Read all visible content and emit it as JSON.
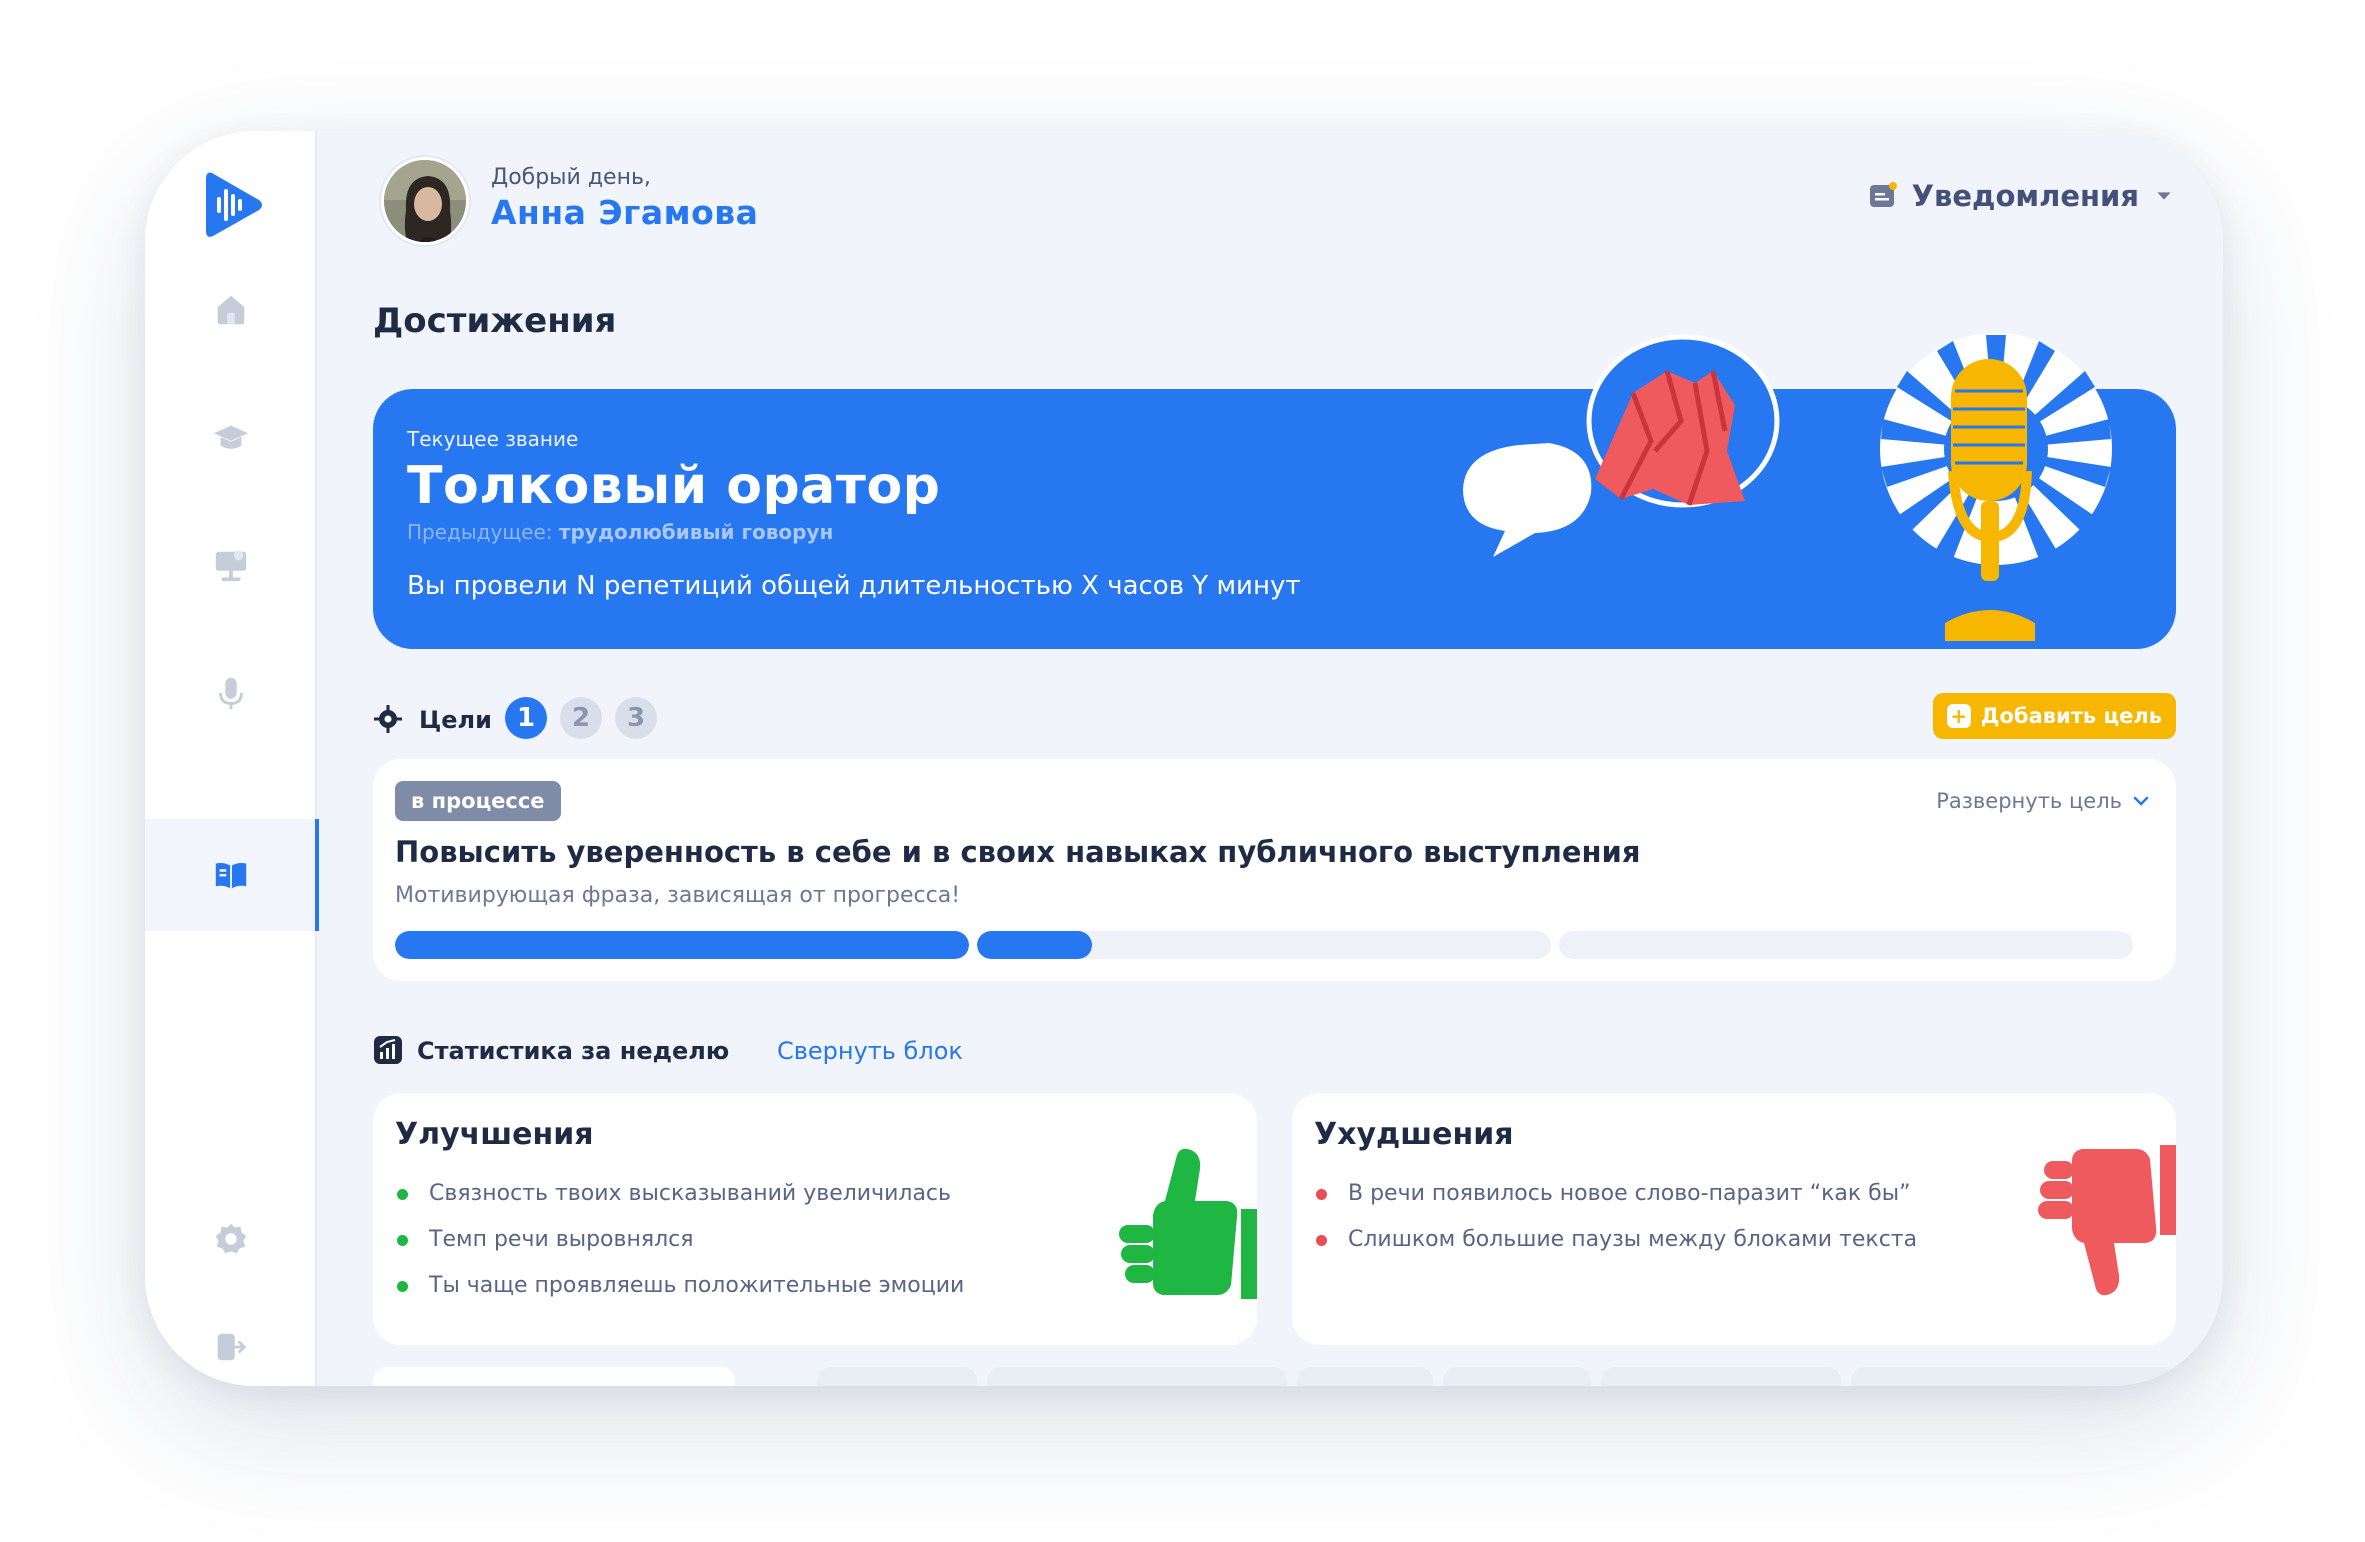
{
  "header": {
    "greeting": "Добрый день,",
    "user_name": "Анна Эгамова",
    "notifications_label": "Уведомления"
  },
  "sidebar": {
    "items": [
      {
        "name": "home",
        "icon": "home-icon"
      },
      {
        "name": "courses",
        "icon": "graduation-cap-icon"
      },
      {
        "name": "presentations",
        "icon": "presentation-icon"
      },
      {
        "name": "recording",
        "icon": "microphone-icon"
      },
      {
        "name": "achievements",
        "icon": "book-icon",
        "active": true
      },
      {
        "name": "settings",
        "icon": "gear-icon"
      },
      {
        "name": "logout",
        "icon": "logout-icon"
      }
    ]
  },
  "page": {
    "title": "Достижения"
  },
  "banner": {
    "current_rank_label": "Текущее звание",
    "current_rank": "Толковый оратор",
    "previous_prefix": "Предыдущее:",
    "previous_rank": "трудолюбивый говорун",
    "stats_text": "Вы провели N репетиций общей длительностью X часов Y минут"
  },
  "goals": {
    "label": "Цели",
    "tabs": [
      "1",
      "2",
      "3"
    ],
    "active_tab": "1",
    "add_button": "Добавить цель",
    "card": {
      "status": "в процессе",
      "expand_label": "Развернуть цель",
      "title": "Повысить уверенность в себе и в своих навыках публичного выступления",
      "motto": "Мотивирующая фраза, зависящая от прогресса!",
      "progress_segments": [
        1.0,
        0.2,
        0.0
      ]
    }
  },
  "weekly_stats": {
    "label": "Статистика за неделю",
    "collapse_link": "Свернуть блок",
    "improvements": {
      "title": "Улучшения",
      "items": [
        "Связность твоих высказываний увеличилась",
        "Темп речи выровнялся",
        "Ты чаще проявляешь положительные эмоции"
      ]
    },
    "declines": {
      "title": "Ухудшения",
      "items": [
        "В речи появилось новое слово-паразит “как бы”",
        "Слишком большие паузы между блоками текста"
      ]
    }
  },
  "colors": {
    "accent": "#2677f0",
    "add_button": "#f7b600",
    "positive": "#1fb644",
    "negative": "#ea4d55",
    "badge": "#7f8ca8"
  }
}
